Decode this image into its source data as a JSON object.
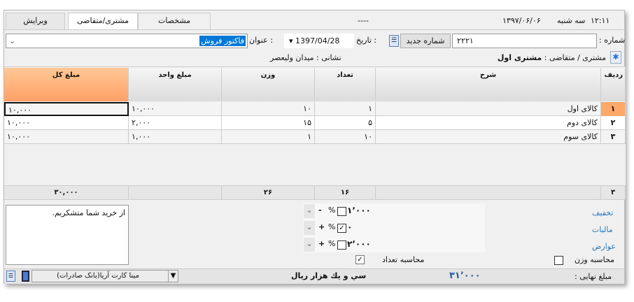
{
  "tabs": [
    {
      "label": "ویرایش"
    },
    {
      "label": "مشتری/متقاضی"
    },
    {
      "label": "مشخصات"
    }
  ],
  "header": {
    "placeholder_dash": "----",
    "date": "۱۳۹۷/۰۶/۰۶",
    "weekday": "سه شنبه",
    "time": "۱۲:۱۱"
  },
  "form": {
    "number_label": "شماره :",
    "number_value": "۲۲۲۱",
    "new_number_button": "شماره جدید",
    "date_label": "تاریخ :",
    "date_value": "1397/04/28",
    "title_label": "عنوان :",
    "title_value": "فاکتور فروش",
    "customer_label": "مشتری / متقاضی :",
    "customer_value": "مشتری اول",
    "address": "نشانی : میدان ولیعصر"
  },
  "grid": {
    "columns": [
      "ردیف",
      "شرح",
      "تعداد",
      "وزن",
      "مبلغ واحد",
      "مبلغ کل"
    ],
    "rows": [
      {
        "row": "۱",
        "desc": "کالای اول",
        "qty": "۱",
        "weight": "۱۰",
        "unit": "۱۰,۰۰۰",
        "total": "۱۰,۰۰۰"
      },
      {
        "row": "۲",
        "desc": "کالای دوم",
        "qty": "۵",
        "weight": "۱۵",
        "unit": "۲,۰۰۰",
        "total": "۱۰,۰۰۰"
      },
      {
        "row": "۳",
        "desc": "کالای سوم",
        "qty": "۱۰",
        "weight": "۱",
        "unit": "۱,۰۰۰",
        "total": "۱۰,۰۰۰"
      }
    ],
    "footer": {
      "row": "۳",
      "qty": "۱۶",
      "weight": "۲۶",
      "total": "۳۰,۰۰۰"
    }
  },
  "notes": "از خرید شما متشکریم.",
  "adjustments": [
    {
      "label": "تخفیف",
      "value": "۱٬۰۰۰",
      "percent_checked": false,
      "sign": "-"
    },
    {
      "label": "مالیات",
      "value": "۰",
      "percent_checked": true,
      "sign": "+"
    },
    {
      "label": "عوارض",
      "value": "۲٬۰۰۰",
      "percent_checked": false,
      "sign": "+"
    }
  ],
  "percent_symbol": "%",
  "options": {
    "calc_weight": "محاسبه وزن",
    "calc_weight_checked": false,
    "calc_count": "محاسبه تعداد",
    "calc_count_checked": true
  },
  "footer": {
    "final_label": "مبلغ نهایی :",
    "final_value": "۳۱٬۰۰۰",
    "final_words": "سي و يك هزار  ريال",
    "payment": "مینا کارت آریا(بانک صادرات)"
  },
  "colors": {
    "accent_orange": "#ffa86a",
    "link_blue": "#2a7ab8",
    "selection": "#0078d7"
  }
}
